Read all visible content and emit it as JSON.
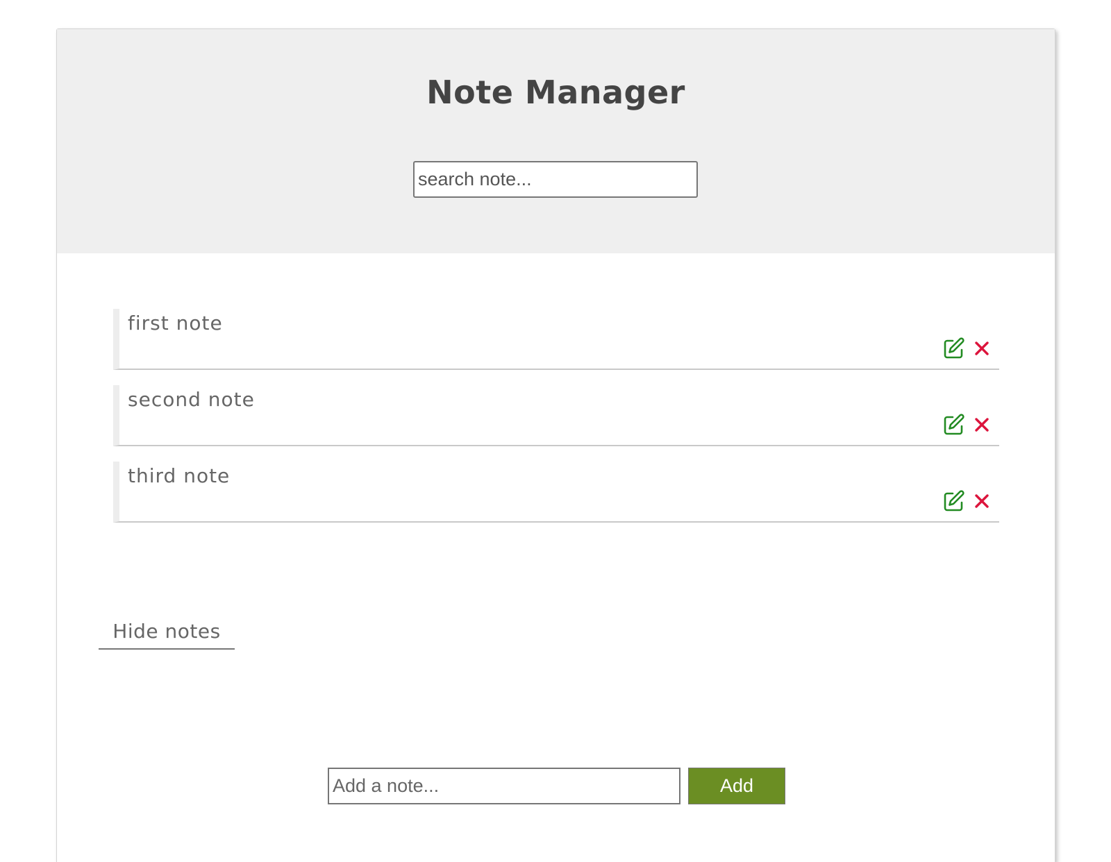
{
  "header": {
    "title": "Note Manager",
    "search_placeholder": "search note..."
  },
  "notes": [
    {
      "text": "first note",
      "edit_icon": "edit-icon",
      "delete_icon": "close-icon"
    },
    {
      "text": "second note",
      "edit_icon": "edit-icon",
      "delete_icon": "close-icon"
    },
    {
      "text": "third note",
      "edit_icon": "edit-icon",
      "delete_icon": "close-icon"
    }
  ],
  "toggle": {
    "label": "Hide notes"
  },
  "add_form": {
    "placeholder": "Add a note...",
    "button_label": "Add"
  },
  "colors": {
    "header_bg": "#efefef",
    "edit_icon": "#228b22",
    "delete_icon": "#dc143c",
    "add_button": "#6b8e23"
  }
}
